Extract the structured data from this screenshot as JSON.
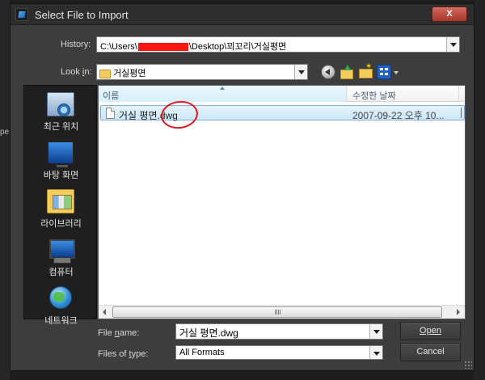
{
  "background": {
    "left_fragment": "pe"
  },
  "window": {
    "title": "Select File to Import",
    "close_label": "X"
  },
  "history": {
    "label": "History:",
    "path_prefix": "C:\\Users\\",
    "path_suffix": "\\Desktop\\꾀꼬리\\거실평면"
  },
  "look_in": {
    "label_prefix": "Look ",
    "label_accel": "i",
    "label_suffix": "n:",
    "value": "거실평면"
  },
  "toolbar": {
    "icons": [
      "back-icon",
      "up-folder-icon",
      "new-folder-icon",
      "view-menu-icon"
    ]
  },
  "places": [
    {
      "label": "최근 위치",
      "icon": "recent-places-icon"
    },
    {
      "label": "바탕 화면",
      "icon": "desktop-icon"
    },
    {
      "label": "라이브러리",
      "icon": "libraries-icon"
    },
    {
      "label": "컴퓨터",
      "icon": "computer-icon"
    },
    {
      "label": "네트워크",
      "icon": "network-icon"
    }
  ],
  "file_list": {
    "columns": {
      "name": "이름",
      "date": "수정한 날짜"
    },
    "files": [
      {
        "name": "거실 평면.dwg",
        "date": "2007-09-22 오후 10..."
      }
    ]
  },
  "file_name": {
    "label_accel": "n",
    "label_prefix": "File ",
    "label_suffix": "ame:",
    "value": "거실 평면.dwg"
  },
  "file_type": {
    "label_prefix": "Files of ",
    "label_accel": "t",
    "label_suffix": "ype:",
    "value": "All Formats"
  },
  "buttons": {
    "open": "Open",
    "cancel": "Cancel"
  },
  "colors": {
    "annotation": "#e01818",
    "redaction": "#ff1414",
    "selection": "#cce8fa"
  }
}
